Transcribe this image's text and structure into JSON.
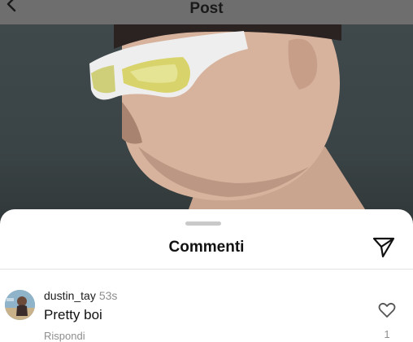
{
  "header": {
    "title": "Post",
    "back_icon": "chevron-left-icon"
  },
  "photo": {
    "description_icon": "post-photo"
  },
  "comments_sheet": {
    "title": "Commenti",
    "share_icon": "paper-plane-icon",
    "comments": [
      {
        "username": "dustin_tay",
        "time": "53s",
        "text": "Pretty boi",
        "reply_label": "Rispondi",
        "like_icon": "heart-outline-icon",
        "like_count": "1"
      }
    ]
  },
  "colors": {
    "header_overlay": "#6e6e6e",
    "photo_bg": "#3b4446",
    "sheet_bg": "#ffffff",
    "secondary_text": "#8e8e8e"
  }
}
